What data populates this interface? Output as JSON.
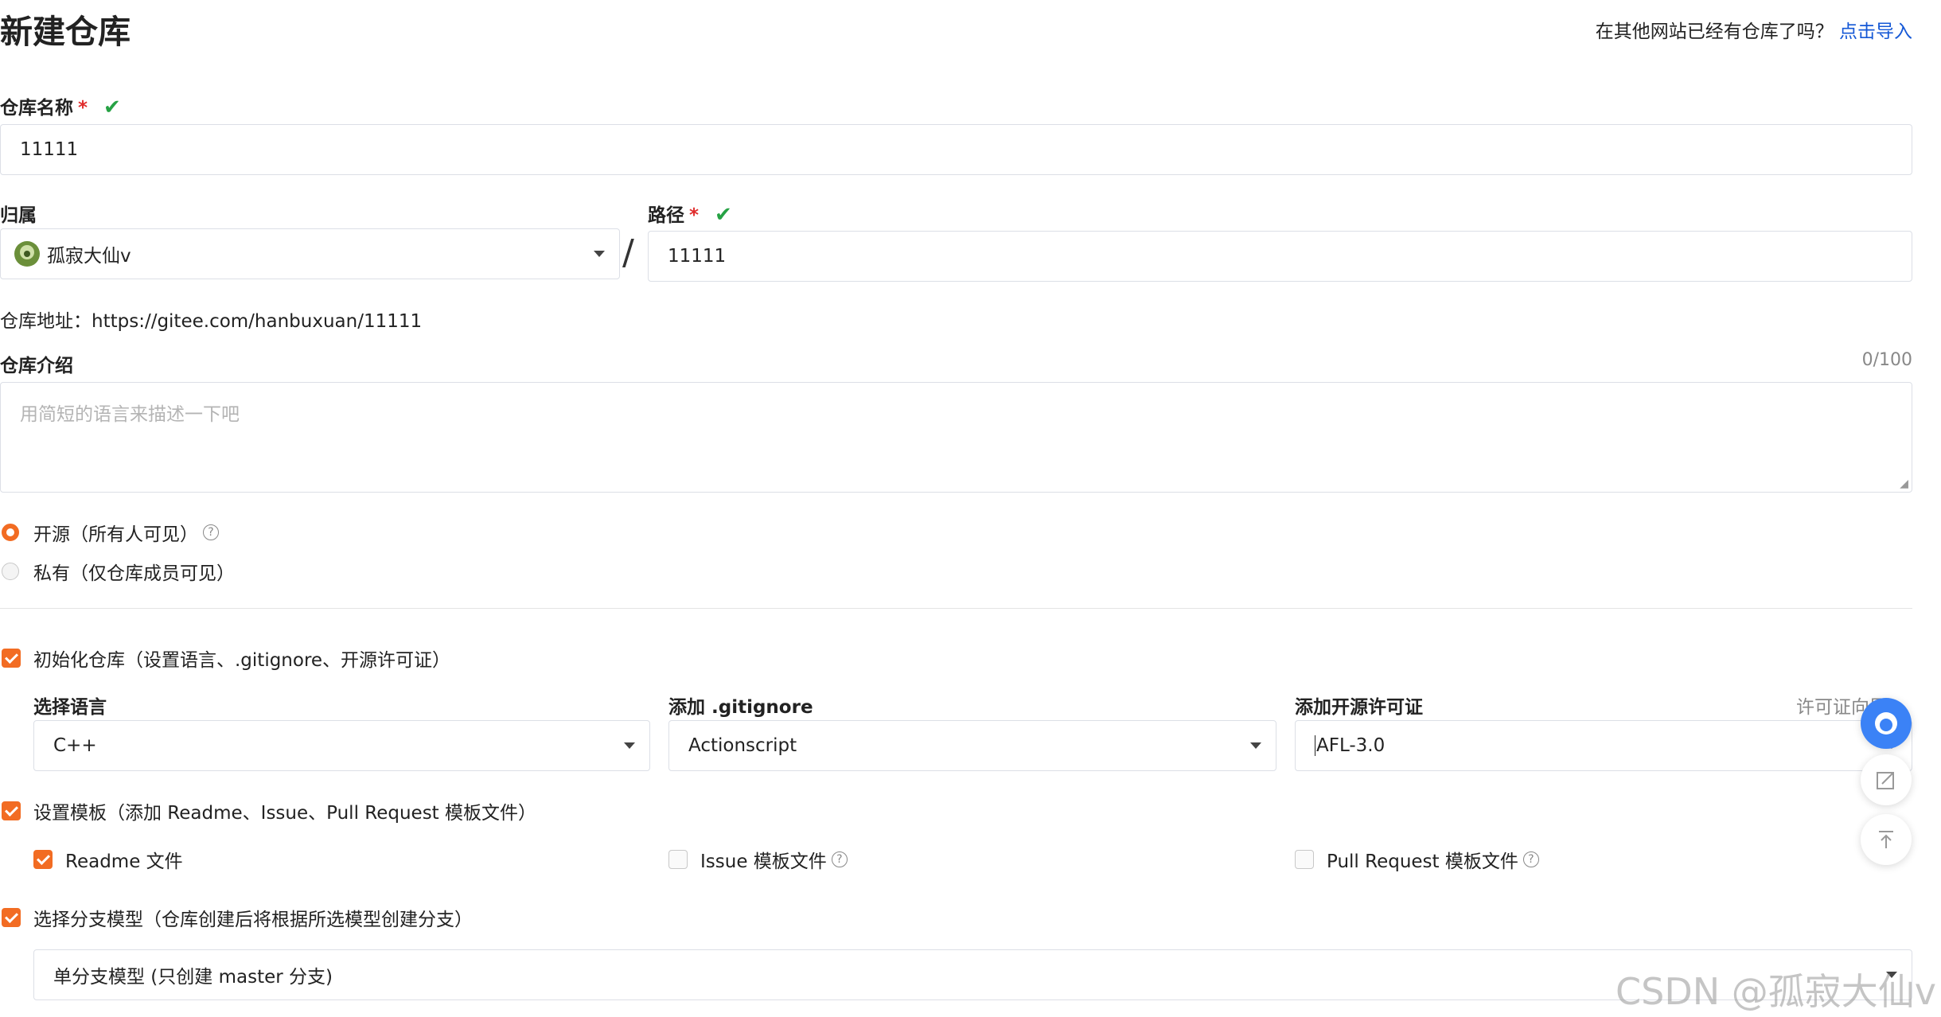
{
  "page": {
    "title": "新建仓库",
    "import_prompt": "在其他网站已经有仓库了吗？",
    "import_link": "点击导入"
  },
  "repo_name": {
    "label": "仓库名称",
    "required": "*",
    "value": "11111"
  },
  "owner": {
    "label": "归属",
    "value": "孤寂大仙v"
  },
  "separator": "/",
  "path": {
    "label": "路径",
    "required": "*",
    "value": "11111"
  },
  "repo_address": {
    "label": "仓库地址：",
    "url": "https://gitee.com/hanbuxuan/11111"
  },
  "description": {
    "label": "仓库介绍",
    "counter": "0/100",
    "placeholder": "用简短的语言来描述一下吧"
  },
  "visibility": {
    "options": [
      {
        "label": "开源",
        "hint": "（所有人可见）",
        "selected": true
      },
      {
        "label": "私有",
        "hint": "（仅仓库成员可见）",
        "selected": false
      }
    ]
  },
  "init_repo": {
    "checked": true,
    "label": "初始化仓库",
    "hint": "（设置语言、.gitignore、开源许可证）",
    "language": {
      "label": "选择语言",
      "value": "C++"
    },
    "gitignore": {
      "label": "添加 .gitignore",
      "value": "Actionscript"
    },
    "license": {
      "label": "添加开源许可证",
      "value": "AFL-3.0",
      "guide": "许可证向导"
    }
  },
  "template": {
    "checked": true,
    "label": "设置模板",
    "hint": "（添加 Readme、Issue、Pull Request 模板文件）",
    "items": [
      {
        "label": "Readme 文件",
        "checked": true
      },
      {
        "label": "Issue 模板文件",
        "checked": false
      },
      {
        "label": "Pull Request 模板文件",
        "checked": false
      }
    ]
  },
  "branch_model": {
    "checked": true,
    "label": "选择分支模型",
    "hint": "（仓库创建后将根据所选模型创建分支）",
    "value": "单分支模型 (只创建 master 分支)"
  },
  "watermark": "CSDN @孤寂大仙v",
  "help_glyph": "?",
  "colors": {
    "accent": "#f26c23",
    "link": "#1558d6",
    "check": "#26a244",
    "required": "#e02c2c"
  }
}
